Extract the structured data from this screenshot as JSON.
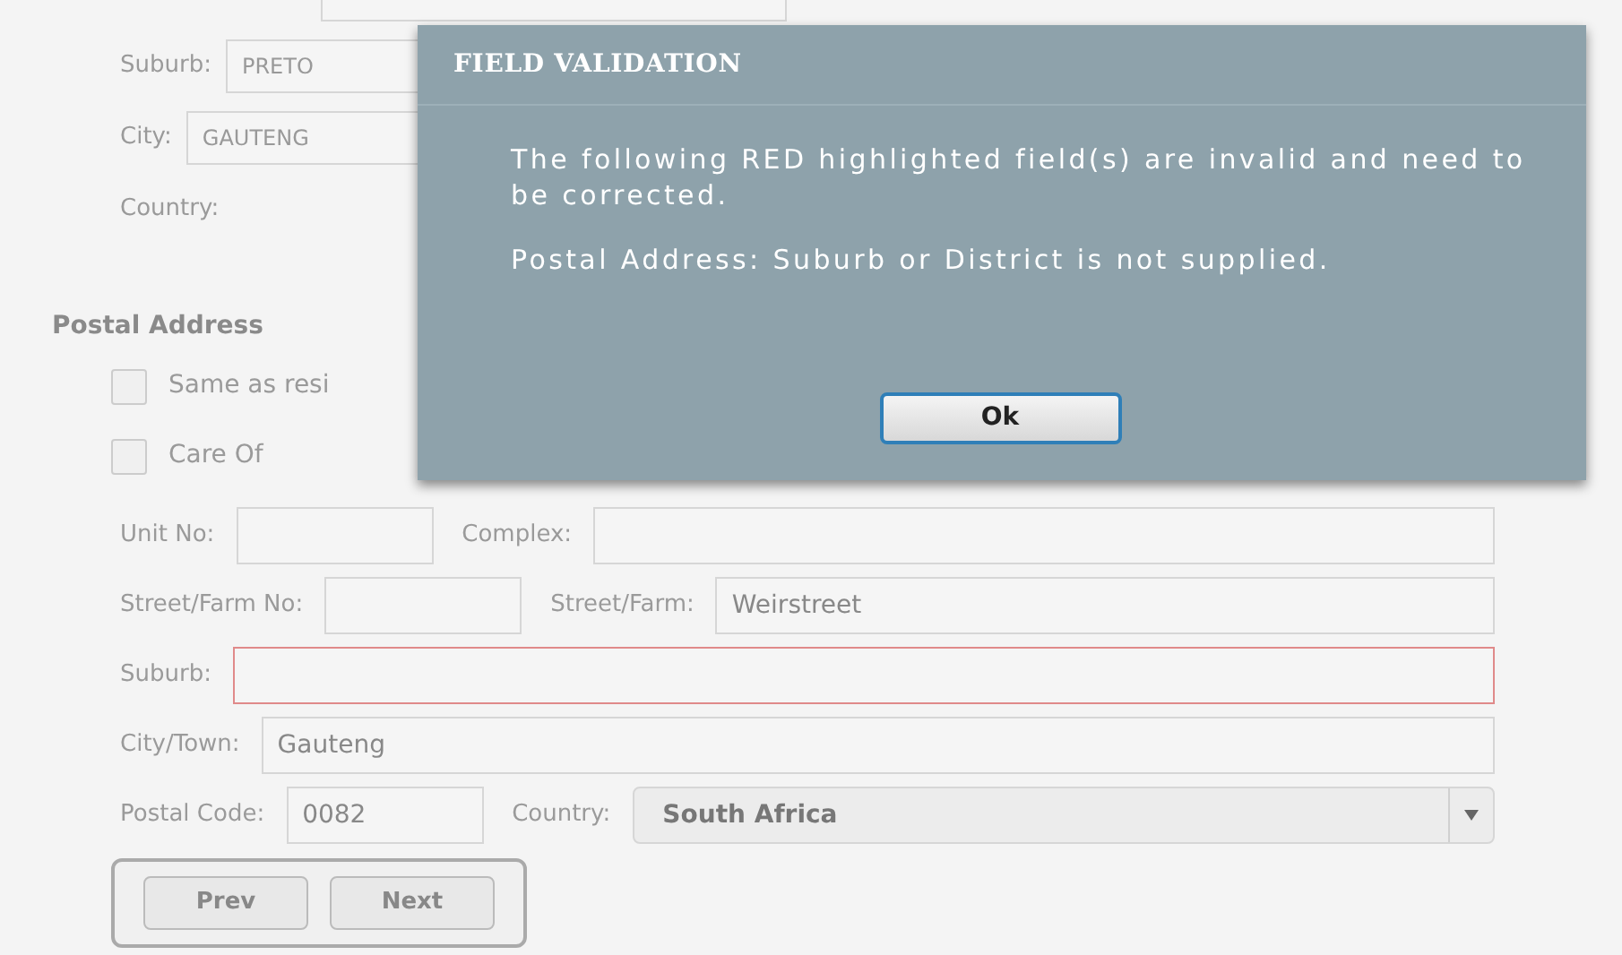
{
  "residential": [
    {
      "label": "Suburb:",
      "value": "PRETO"
    },
    {
      "label": "City:",
      "value": "GAUTENG"
    },
    {
      "label": "Country:"
    }
  ],
  "postal_address": {
    "heading": "Postal Address",
    "checkboxes": [
      {
        "label": "Same as resi",
        "checked": false
      },
      {
        "label": "Care Of",
        "checked": false
      }
    ],
    "rows": [
      [
        {
          "label": "Unit No:",
          "kind": "text",
          "invalid": false
        },
        {
          "label": "Complex:",
          "kind": "text",
          "invalid": false
        }
      ],
      [
        {
          "label": "Street/Farm No:",
          "kind": "text",
          "invalid": false
        },
        {
          "label": "Street/Farm:",
          "kind": "text",
          "value": "Weirstreet",
          "invalid": false
        }
      ],
      [
        {
          "label": "Suburb:",
          "kind": "text",
          "invalid": true
        }
      ],
      [
        {
          "label": "City/Town:",
          "kind": "text",
          "value": "Gauteng",
          "invalid": false
        }
      ],
      [
        {
          "label": "Postal Code:",
          "kind": "text",
          "value": "0082",
          "invalid": false
        },
        {
          "label": "Country:",
          "kind": "select",
          "value": "South Africa",
          "invalid": false
        }
      ]
    ]
  },
  "nav_buttons": [
    "Prev",
    "Next"
  ],
  "dialog": {
    "title": "FIELD VALIDATION",
    "messages": [
      "The following RED highlighted field(s) are invalid and need to be corrected.",
      "Postal Address: Suburb or District is not supplied."
    ],
    "button": "Ok"
  }
}
